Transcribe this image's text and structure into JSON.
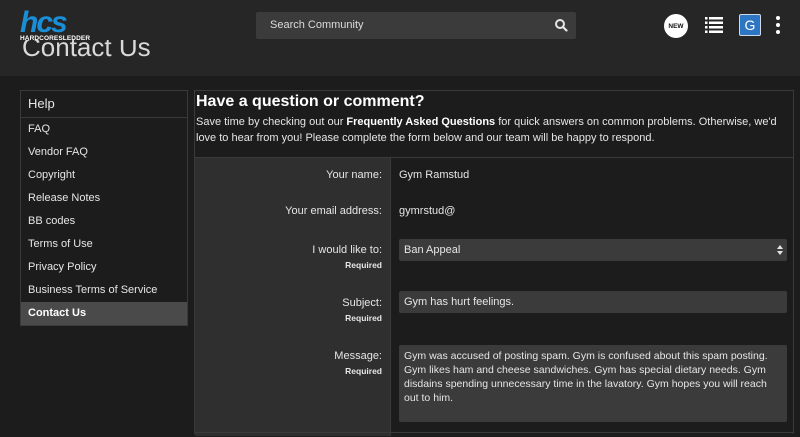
{
  "header": {
    "logo_mark": "hcs",
    "logo_sub": "HARDCORESLEDDER",
    "search_placeholder": "Search Community",
    "new_badge": "NEW",
    "avatar_letter": "G",
    "page_title": "Contact Us"
  },
  "sidebar": {
    "title": "Help",
    "items": [
      {
        "label": "FAQ"
      },
      {
        "label": "Vendor FAQ"
      },
      {
        "label": "Copyright"
      },
      {
        "label": "Release Notes"
      },
      {
        "label": "BB codes"
      },
      {
        "label": "Terms of Use"
      },
      {
        "label": "Privacy Policy"
      },
      {
        "label": "Business Terms of Service"
      },
      {
        "label": "Contact Us"
      }
    ]
  },
  "main": {
    "title": "Have a question or comment?",
    "intro_pre": "Save time by checking out our ",
    "intro_link": "Frequently Asked Questions",
    "intro_post": " for quick answers on common problems. Otherwise, we'd love to hear from you! Please complete the form below and our team will be happy to respond."
  },
  "form": {
    "name_label": "Your name:",
    "name_value": "Gym Ramstud",
    "email_label": "Your email address:",
    "email_value": "gymrstud@",
    "action_label": "I would like to:",
    "action_required": "Required",
    "action_value": "Ban Appeal",
    "subject_label": "Subject:",
    "subject_required": "Required",
    "subject_value": "Gym has hurt feelings.",
    "message_label": "Message:",
    "message_required": "Required",
    "message_value": "Gym was accused of posting spam.  Gym is confused about this spam posting.  Gym likes ham and cheese sandwiches.  Gym has special dietary needs.  Gym disdains spending unnecessary time in the lavatory.  Gym hopes you will reach out to him."
  },
  "colors": {
    "background": "#1c1c1c",
    "header": "#262626",
    "accent_logo": "#1a8fd8",
    "avatar": "#2d76c4",
    "field": "#3b3b3b",
    "active_item": "#4a4a4a"
  }
}
